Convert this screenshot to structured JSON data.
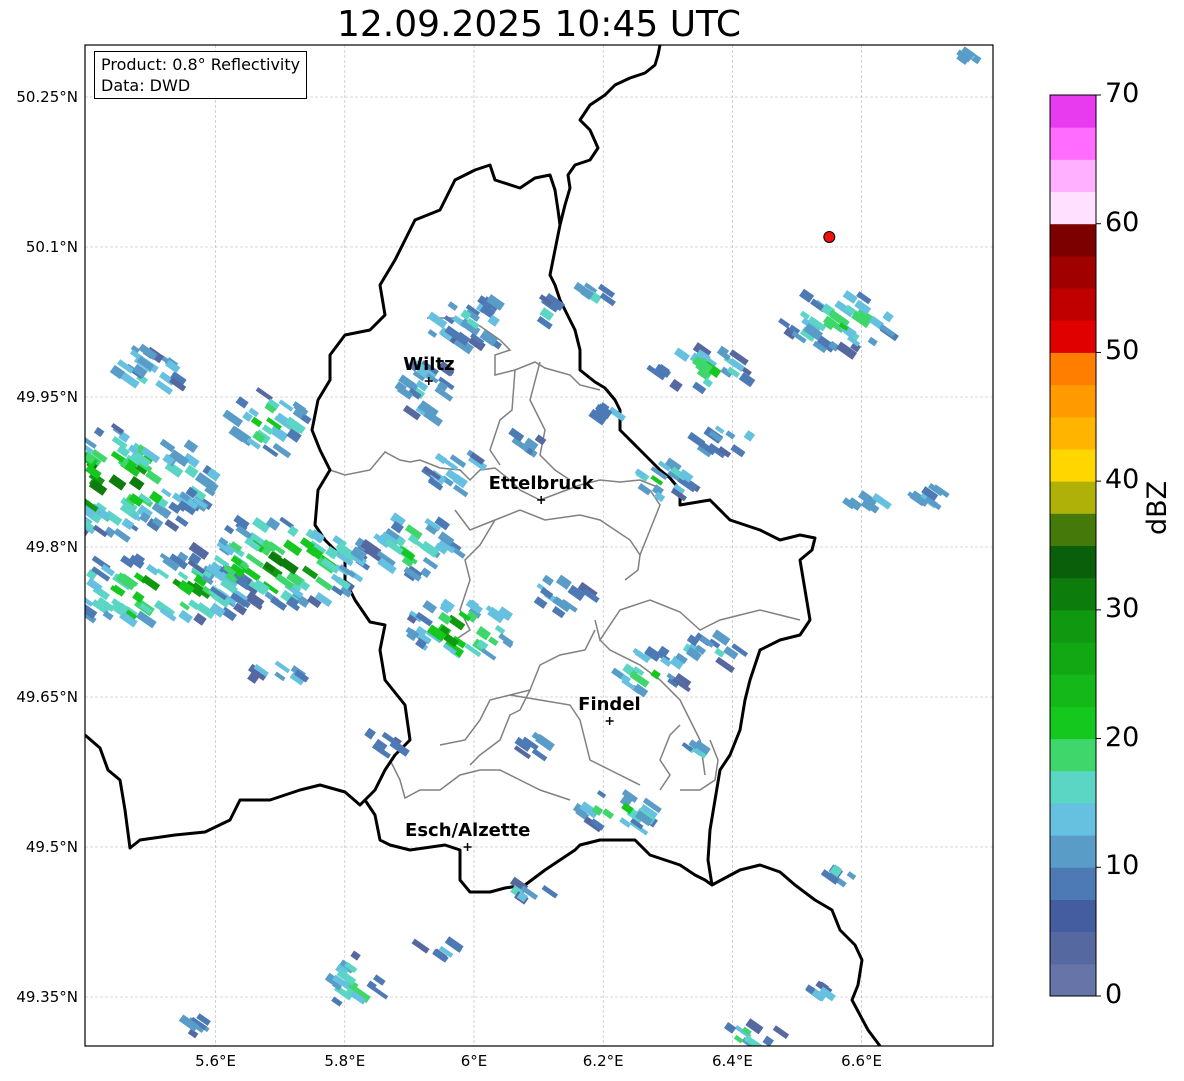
{
  "title": "12.09.2025 10:45 UTC",
  "info": {
    "product": "Product: 0.8° Reflectivity",
    "source": "Data: DWD"
  },
  "axes": {
    "lat_ticks": [
      "50.25°N",
      "50.1°N",
      "49.95°N",
      "49.8°N",
      "49.65°N",
      "49.5°N",
      "49.35°N"
    ],
    "lon_ticks": [
      "5.6°E",
      "5.8°E",
      "6°E",
      "6.2°E",
      "6.4°E",
      "6.6°E"
    ],
    "grid": true
  },
  "colorbar": {
    "label": "dBZ",
    "ticks": [
      "70",
      "60",
      "50",
      "40",
      "30",
      "20",
      "10",
      "0"
    ],
    "min": 0,
    "max": 70,
    "step": 2.5,
    "colors": [
      "#6674a8",
      "#5568a0",
      "#445ca0",
      "#4d7ab4",
      "#5a9cc8",
      "#66c0e0",
      "#5cd6c4",
      "#3fd66c",
      "#14c81e",
      "#14b818",
      "#12a814",
      "#109810",
      "#0c7c0c",
      "#0a600a",
      "#457a0a",
      "#afb008",
      "#ffd600",
      "#ffb400",
      "#ff9a00",
      "#ff7e00",
      "#e00000",
      "#c00000",
      "#a00000",
      "#7c0000",
      "#ffe0ff",
      "#ffb0ff",
      "#ff6cff",
      "#e83aee"
    ]
  },
  "cities": [
    {
      "name": "Wiltz",
      "lon": 5.93,
      "lat": 49.966
    },
    {
      "name": "Ettelbruck",
      "lon": 6.104,
      "lat": 49.847
    },
    {
      "name": "Findel",
      "lon": 6.21,
      "lat": 49.626
    },
    {
      "name": "Esch/Alzette",
      "lon": 5.99,
      "lat": 49.5
    }
  ],
  "marker": {
    "lon": 6.55,
    "lat": 50.11,
    "color": "#ee1111"
  }
}
